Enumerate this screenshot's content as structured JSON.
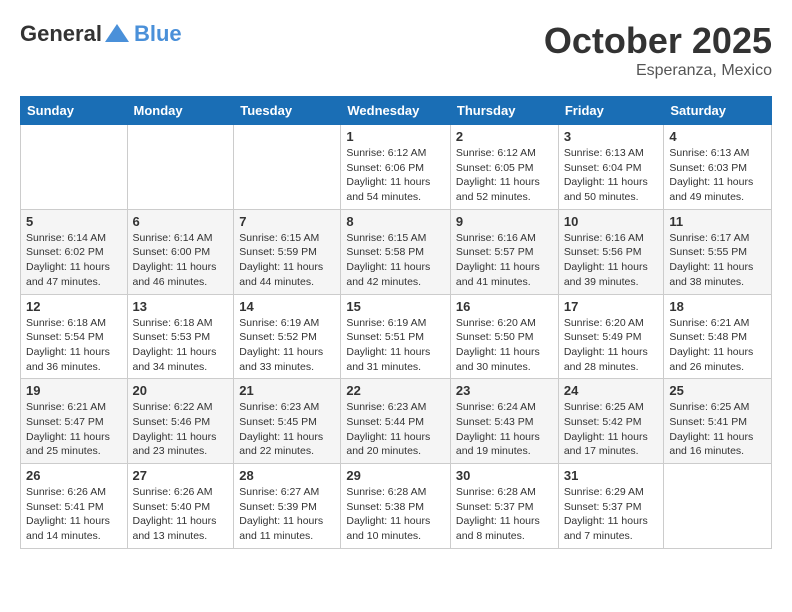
{
  "header": {
    "logo_general": "General",
    "logo_blue": "Blue",
    "month": "October 2025",
    "location": "Esperanza, Mexico"
  },
  "days_of_week": [
    "Sunday",
    "Monday",
    "Tuesday",
    "Wednesday",
    "Thursday",
    "Friday",
    "Saturday"
  ],
  "weeks": [
    [
      {
        "day": "",
        "info": ""
      },
      {
        "day": "",
        "info": ""
      },
      {
        "day": "",
        "info": ""
      },
      {
        "day": "1",
        "info": "Sunrise: 6:12 AM\nSunset: 6:06 PM\nDaylight: 11 hours\nand 54 minutes."
      },
      {
        "day": "2",
        "info": "Sunrise: 6:12 AM\nSunset: 6:05 PM\nDaylight: 11 hours\nand 52 minutes."
      },
      {
        "day": "3",
        "info": "Sunrise: 6:13 AM\nSunset: 6:04 PM\nDaylight: 11 hours\nand 50 minutes."
      },
      {
        "day": "4",
        "info": "Sunrise: 6:13 AM\nSunset: 6:03 PM\nDaylight: 11 hours\nand 49 minutes."
      }
    ],
    [
      {
        "day": "5",
        "info": "Sunrise: 6:14 AM\nSunset: 6:02 PM\nDaylight: 11 hours\nand 47 minutes."
      },
      {
        "day": "6",
        "info": "Sunrise: 6:14 AM\nSunset: 6:00 PM\nDaylight: 11 hours\nand 46 minutes."
      },
      {
        "day": "7",
        "info": "Sunrise: 6:15 AM\nSunset: 5:59 PM\nDaylight: 11 hours\nand 44 minutes."
      },
      {
        "day": "8",
        "info": "Sunrise: 6:15 AM\nSunset: 5:58 PM\nDaylight: 11 hours\nand 42 minutes."
      },
      {
        "day": "9",
        "info": "Sunrise: 6:16 AM\nSunset: 5:57 PM\nDaylight: 11 hours\nand 41 minutes."
      },
      {
        "day": "10",
        "info": "Sunrise: 6:16 AM\nSunset: 5:56 PM\nDaylight: 11 hours\nand 39 minutes."
      },
      {
        "day": "11",
        "info": "Sunrise: 6:17 AM\nSunset: 5:55 PM\nDaylight: 11 hours\nand 38 minutes."
      }
    ],
    [
      {
        "day": "12",
        "info": "Sunrise: 6:18 AM\nSunset: 5:54 PM\nDaylight: 11 hours\nand 36 minutes."
      },
      {
        "day": "13",
        "info": "Sunrise: 6:18 AM\nSunset: 5:53 PM\nDaylight: 11 hours\nand 34 minutes."
      },
      {
        "day": "14",
        "info": "Sunrise: 6:19 AM\nSunset: 5:52 PM\nDaylight: 11 hours\nand 33 minutes."
      },
      {
        "day": "15",
        "info": "Sunrise: 6:19 AM\nSunset: 5:51 PM\nDaylight: 11 hours\nand 31 minutes."
      },
      {
        "day": "16",
        "info": "Sunrise: 6:20 AM\nSunset: 5:50 PM\nDaylight: 11 hours\nand 30 minutes."
      },
      {
        "day": "17",
        "info": "Sunrise: 6:20 AM\nSunset: 5:49 PM\nDaylight: 11 hours\nand 28 minutes."
      },
      {
        "day": "18",
        "info": "Sunrise: 6:21 AM\nSunset: 5:48 PM\nDaylight: 11 hours\nand 26 minutes."
      }
    ],
    [
      {
        "day": "19",
        "info": "Sunrise: 6:21 AM\nSunset: 5:47 PM\nDaylight: 11 hours\nand 25 minutes."
      },
      {
        "day": "20",
        "info": "Sunrise: 6:22 AM\nSunset: 5:46 PM\nDaylight: 11 hours\nand 23 minutes."
      },
      {
        "day": "21",
        "info": "Sunrise: 6:23 AM\nSunset: 5:45 PM\nDaylight: 11 hours\nand 22 minutes."
      },
      {
        "day": "22",
        "info": "Sunrise: 6:23 AM\nSunset: 5:44 PM\nDaylight: 11 hours\nand 20 minutes."
      },
      {
        "day": "23",
        "info": "Sunrise: 6:24 AM\nSunset: 5:43 PM\nDaylight: 11 hours\nand 19 minutes."
      },
      {
        "day": "24",
        "info": "Sunrise: 6:25 AM\nSunset: 5:42 PM\nDaylight: 11 hours\nand 17 minutes."
      },
      {
        "day": "25",
        "info": "Sunrise: 6:25 AM\nSunset: 5:41 PM\nDaylight: 11 hours\nand 16 minutes."
      }
    ],
    [
      {
        "day": "26",
        "info": "Sunrise: 6:26 AM\nSunset: 5:41 PM\nDaylight: 11 hours\nand 14 minutes."
      },
      {
        "day": "27",
        "info": "Sunrise: 6:26 AM\nSunset: 5:40 PM\nDaylight: 11 hours\nand 13 minutes."
      },
      {
        "day": "28",
        "info": "Sunrise: 6:27 AM\nSunset: 5:39 PM\nDaylight: 11 hours\nand 11 minutes."
      },
      {
        "day": "29",
        "info": "Sunrise: 6:28 AM\nSunset: 5:38 PM\nDaylight: 11 hours\nand 10 minutes."
      },
      {
        "day": "30",
        "info": "Sunrise: 6:28 AM\nSunset: 5:37 PM\nDaylight: 11 hours\nand 8 minutes."
      },
      {
        "day": "31",
        "info": "Sunrise: 6:29 AM\nSunset: 5:37 PM\nDaylight: 11 hours\nand 7 minutes."
      },
      {
        "day": "",
        "info": ""
      }
    ]
  ]
}
